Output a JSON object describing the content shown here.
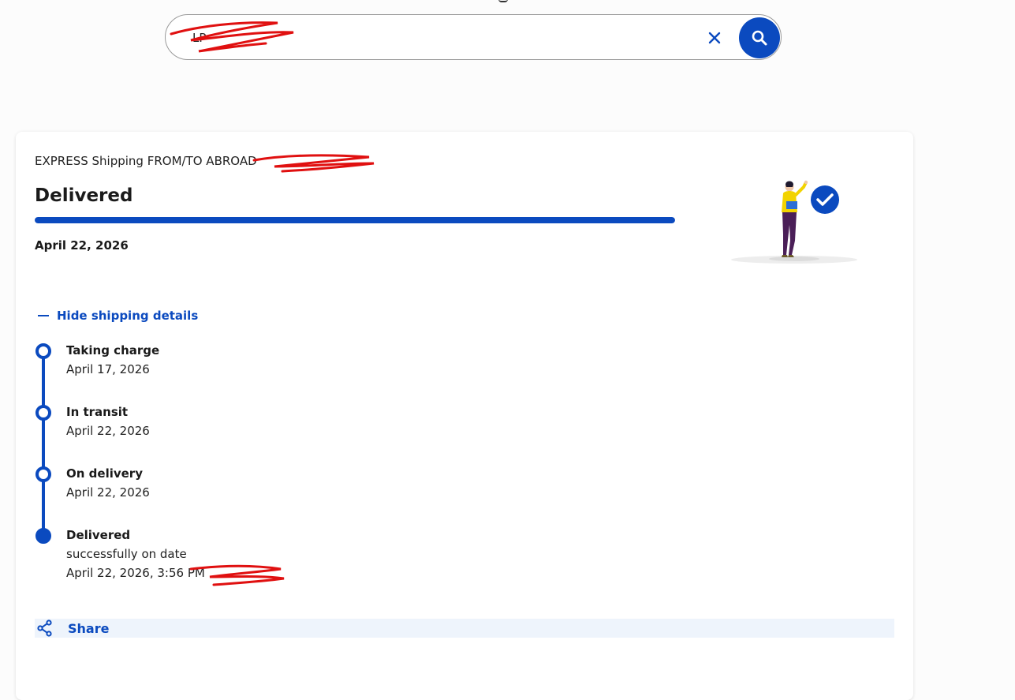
{
  "search": {
    "value": "LP",
    "clear_icon": "close-icon",
    "submit_icon": "search-icon"
  },
  "shipment": {
    "service": "EXPRESS Shipping FROM/TO ABROAD",
    "status": "Delivered",
    "progress": 1.0,
    "status_date": "April 22, 2026",
    "illustration_icon": "delivered-check-icon"
  },
  "details_toggle": {
    "label": "Hide shipping details",
    "icon": "minus-icon"
  },
  "timeline": [
    {
      "title": "Taking charge",
      "date": "April 17, 2026",
      "extra": ""
    },
    {
      "title": "In transit",
      "date": "April 22, 2026",
      "extra": ""
    },
    {
      "title": "On delivery",
      "date": "April 22, 2026",
      "extra": ""
    },
    {
      "title": "Delivered",
      "date": "successfully on date",
      "extra": "April 22, 2026, 3:56 PM"
    }
  ],
  "share": {
    "label": "Share",
    "icon": "share-icon"
  },
  "colors": {
    "accent": "#0b4abf",
    "redaction": "#e01010"
  }
}
